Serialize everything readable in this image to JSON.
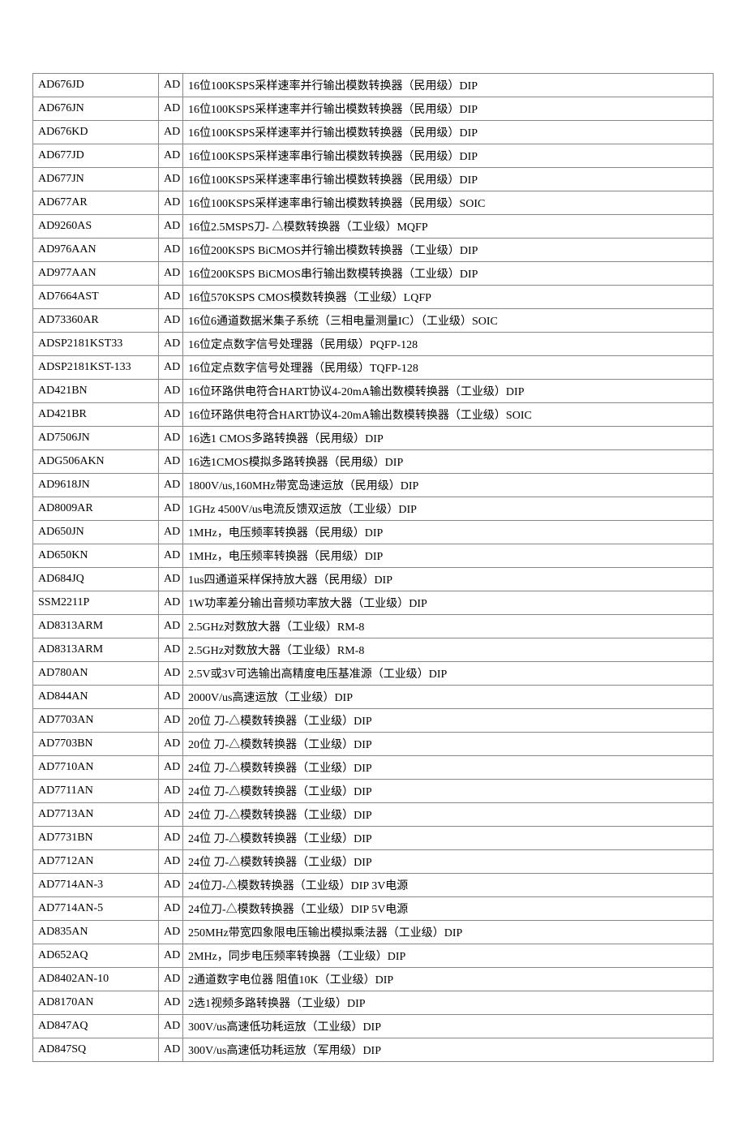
{
  "rows": [
    {
      "pn": "AD676JD",
      "mfr": "AD",
      "desc": "16位100KSPS采样速率并行输出模数转换器（民用级）DIP"
    },
    {
      "pn": "AD676JN",
      "mfr": "AD",
      "desc": "16位100KSPS采样速率并行输出模数转换器（民用级）DIP"
    },
    {
      "pn": "AD676KD",
      "mfr": "AD",
      "desc": "16位100KSPS采样速率并行输出模数转换器（民用级）DIP"
    },
    {
      "pn": "AD677JD",
      "mfr": "AD",
      "desc": "16位100KSPS采样速率串行输出模数转换器（民用级）DIP"
    },
    {
      "pn": "AD677JN",
      "mfr": "AD",
      "desc": "16位100KSPS采样速率串行输出模数转换器（民用级）DIP"
    },
    {
      "pn": "AD677AR",
      "mfr": "AD",
      "desc": "16位100KSPS采样速率串行输出模数转换器（民用级）SOIC"
    },
    {
      "pn": "AD9260AS",
      "mfr": "AD",
      "desc": "16位2.5MSPS刀- △模数转换器（工业级）MQFP"
    },
    {
      "pn": "AD976AAN",
      "mfr": "AD",
      "desc": "16位200KSPS BiCMOS并行输出模数转换器（工业级）DIP"
    },
    {
      "pn": "AD977AAN",
      "mfr": "AD",
      "desc": "16位200KSPS BiCMOS串行输出数模转换器（工业级）DIP"
    },
    {
      "pn": "AD7664AST",
      "mfr": "AD",
      "desc": "16位570KSPS CMOS模数转换器（工业级）LQFP"
    },
    {
      "pn": "AD73360AR",
      "mfr": "AD",
      "desc": "16位6通道数据米集子系统（三相电量测量IC）（工业级）SOIC"
    },
    {
      "pn": "ADSP2181KST33",
      "mfr": "AD",
      "desc": "16位定点数字信号处理器（民用级）PQFP-128"
    },
    {
      "pn": "ADSP2181KST-133",
      "mfr": "AD",
      "desc": "16位定点数字信号处理器（民用级）TQFP-128"
    },
    {
      "pn": "AD421BN",
      "mfr": "AD",
      "desc": "16位环路供电符合HART协议4-20mA输出数模转换器（工业级）DIP"
    },
    {
      "pn": "AD421BR",
      "mfr": "AD",
      "desc": "16位环路供电符合HART协议4-20mA输出数模转换器（工业级）SOIC"
    },
    {
      "pn": "AD7506JN",
      "mfr": "AD",
      "desc": "16选1 CMOS多路转换器（民用级）DIP"
    },
    {
      "pn": "ADG506AKN",
      "mfr": "AD",
      "desc": "16选1CMOS模拟多路转换器（民用级）DIP"
    },
    {
      "pn": "AD9618JN",
      "mfr": "AD",
      "desc": "1800V/us,160MHz带宽岛速运放（民用级）DIP"
    },
    {
      "pn": "AD8009AR",
      "mfr": "AD",
      "desc": "1GHz 4500V/us电流反馈双运放（工业级）DIP"
    },
    {
      "pn": "AD650JN",
      "mfr": "AD",
      "desc": "1MHz，电压频率转换器（民用级）DIP"
    },
    {
      "pn": "AD650KN",
      "mfr": "AD",
      "desc": "1MHz，电压频率转换器（民用级）DIP"
    },
    {
      "pn": "AD684JQ",
      "mfr": "AD",
      "desc": "1us四通道采样保持放大器（民用级）DIP"
    },
    {
      "pn": "SSM2211P",
      "mfr": "AD",
      "desc": "1W功率差分输出音频功率放大器（工业级）DIP"
    },
    {
      "pn": "AD8313ARM",
      "mfr": "AD",
      "desc": "2.5GHz对数放大器（工业级）RM-8"
    },
    {
      "pn": "AD8313ARM",
      "mfr": "AD",
      "desc": "2.5GHz对数放大器（工业级）RM-8"
    },
    {
      "pn": "AD780AN",
      "mfr": "AD",
      "desc": "2.5V或3V可选输出高精度电压基准源（工业级）DIP"
    },
    {
      "pn": "AD844AN",
      "mfr": "AD",
      "desc": "2000V/us高速运放（工业级）DIP"
    },
    {
      "pn": "AD7703AN",
      "mfr": "AD",
      "desc": "20位 刀-△模数转换器（工业级）DIP"
    },
    {
      "pn": "AD7703BN",
      "mfr": "AD",
      "desc": "20位 刀-△模数转换器（工业级）DIP"
    },
    {
      "pn": "AD7710AN",
      "mfr": "AD",
      "desc": "24位 刀-△模数转换器（工业级）DIP"
    },
    {
      "pn": "AD7711AN",
      "mfr": "AD",
      "desc": "24位 刀-△模数转换器（工业级）DIP"
    },
    {
      "pn": "AD7713AN",
      "mfr": "AD",
      "desc": "24位 刀-△模数转换器（工业级）DIP"
    },
    {
      "pn": "AD7731BN",
      "mfr": "AD",
      "desc": "24位 刀-△模数转换器（工业级）DIP"
    },
    {
      "pn": "AD7712AN",
      "mfr": "AD",
      "desc": "24位 刀-△模数转换器（工业级）DIP"
    },
    {
      "pn": "AD7714AN-3",
      "mfr": "AD",
      "desc": "24位刀-△模数转换器（工业级）DIP 3V电源"
    },
    {
      "pn": "AD7714AN-5",
      "mfr": "AD",
      "desc": "24位刀-△模数转换器（工业级）DIP 5V电源"
    },
    {
      "pn": "AD835AN",
      "mfr": "AD",
      "desc": "250MHz带宽四象限电压输出模拟乘法器（工业级）DIP"
    },
    {
      "pn": "AD652AQ",
      "mfr": "AD",
      "desc": "2MHz，同步电压频率转换器（工业级）DIP"
    },
    {
      "pn": "AD8402AN-10",
      "mfr": "AD",
      "desc": "2通道数字电位器 阻值10K（工业级）DIP"
    },
    {
      "pn": "AD8170AN",
      "mfr": "AD",
      "desc": "2选1视频多路转换器（工业级）DIP"
    },
    {
      "pn": "AD847AQ",
      "mfr": "AD",
      "desc": "300V/us高速低功耗运放（工业级）DIP"
    },
    {
      "pn": "AD847SQ",
      "mfr": "AD",
      "desc": "300V/us高速低功耗运放（军用级）DIP"
    }
  ]
}
